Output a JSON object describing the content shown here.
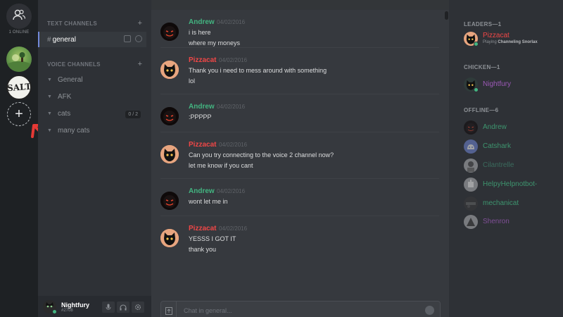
{
  "servers": {
    "online_count": "1 ONLINE",
    "items": [
      {
        "name": "green-hills-server"
      },
      {
        "name": "salt-server",
        "label": "SALT"
      }
    ],
    "add_label": "+"
  },
  "channels": {
    "text_header": "TEXT CHANNELS",
    "voice_header": "VOICE CHANNELS",
    "active_text": {
      "hash": "#",
      "name": "general"
    },
    "voice": [
      {
        "name": "General"
      },
      {
        "name": "AFK"
      },
      {
        "name": "cats",
        "badge": "0 / 2"
      },
      {
        "name": "many cats"
      }
    ]
  },
  "user": {
    "name": "Nightfury",
    "discriminator": "#2708"
  },
  "chat": {
    "messages": [
      {
        "author": "Andrew",
        "color": "#43b581",
        "time": "04/02/2016",
        "lines": [
          "i is here",
          "where my moneys"
        ]
      },
      {
        "author": "Pizzacat",
        "color": "#f04747",
        "time": "04/02/2016",
        "lines": [
          "Thank you i need to mess around with something",
          "lol"
        ]
      },
      {
        "author": "Andrew",
        "color": "#43b581",
        "time": "04/02/2016",
        "lines": [
          ":PPPPP"
        ]
      },
      {
        "author": "Pizzacat",
        "color": "#f04747",
        "time": "04/02/2016",
        "lines": [
          "Can you try connecting to the voice 2 channel now?",
          "let me know if you cant"
        ]
      },
      {
        "author": "Andrew",
        "color": "#43b581",
        "time": "04/02/2016",
        "lines": [
          "wont let me in"
        ]
      },
      {
        "author": "Pizzacat",
        "color": "#f04747",
        "time": "04/02/2016",
        "lines": [
          "YESSS I GOT IT",
          "thank you"
        ]
      }
    ],
    "placeholder": "Chat in general..."
  },
  "members": {
    "groups": [
      {
        "header": "LEADERS—1",
        "members": [
          {
            "name": "Pizzacat",
            "color": "#f04747",
            "game_prefix": "Playing",
            "game": "Channeling Snorlax"
          }
        ]
      },
      {
        "header": "CHICKEN—1",
        "members": [
          {
            "name": "Nightfury",
            "color": "#9b59b6"
          }
        ]
      },
      {
        "header": "OFFLINE—6",
        "members": [
          {
            "name": "Andrew",
            "color": "#43b581"
          },
          {
            "name": "Catshark",
            "color": "#43b581"
          },
          {
            "name": "Cilantrelle",
            "color": "#3f7f6a"
          },
          {
            "name": "HelpyHelpnotbot-",
            "color": "#43b581"
          },
          {
            "name": "mechanicat",
            "color": "#43b581"
          },
          {
            "name": "Shenron",
            "color": "#9b59b6"
          }
        ]
      }
    ]
  },
  "colors": {
    "accent": "#7289da",
    "online": "#43b581",
    "arrow": "#e53935"
  }
}
